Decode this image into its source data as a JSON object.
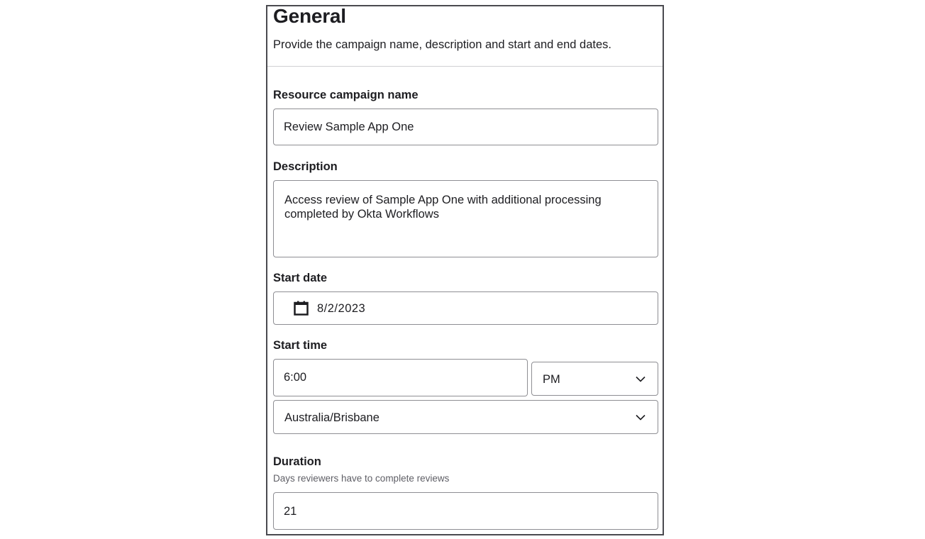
{
  "section": {
    "title": "General",
    "description": "Provide the campaign name, description and start and end dates."
  },
  "campaign_name": {
    "label": "Resource campaign name",
    "value": "Review Sample App One"
  },
  "description": {
    "label": "Description",
    "value": "Access review of Sample App One with additional processing completed by Okta Workflows"
  },
  "start_date": {
    "label": "Start date",
    "icon": "calendar-icon",
    "value": "8/2/2023"
  },
  "start_time": {
    "label": "Start time",
    "time_value": "6:00",
    "meridiem": "PM",
    "timezone": "Australia/Brisbane"
  },
  "duration": {
    "label": "Duration",
    "hint": "Days reviewers have to complete reviews",
    "value": "21"
  },
  "colors": {
    "panel_border": "#4a4a4f",
    "input_border": "#8e8e93",
    "text": "#1d1d21",
    "hint": "#5f5f66",
    "divider": "#cfcfd3"
  }
}
